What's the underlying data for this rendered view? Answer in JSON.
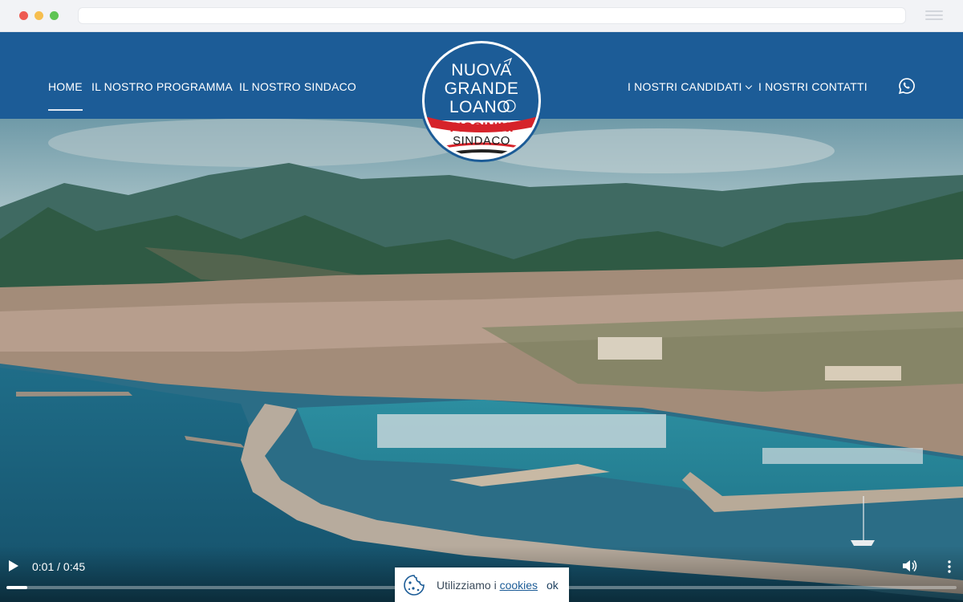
{
  "nav": {
    "left": [
      {
        "label": "HOME",
        "active": true
      },
      {
        "label": "IL NOSTRO PROGRAMMA"
      },
      {
        "label": "IL NOSTRO SINDACO"
      }
    ],
    "right": [
      {
        "label": "I NOSTRI CANDIDATI",
        "dropdown": true
      },
      {
        "label": "I NOSTRI CONTATTI"
      }
    ],
    "social_icon": "whatsapp-icon"
  },
  "logo": {
    "line1": "NUOVA",
    "line2": "GRANDE",
    "line3": "LOANO",
    "name": "PICCININI",
    "role": "SINDACO"
  },
  "video": {
    "time": "0:01 / 0:45",
    "progress_fraction": 0.022
  },
  "cookie": {
    "text": "Utilizziamo i ",
    "link": "cookies",
    "ok": "ok"
  },
  "colors": {
    "brand_blue": "#1c5c97",
    "logo_red": "#d6232a"
  }
}
